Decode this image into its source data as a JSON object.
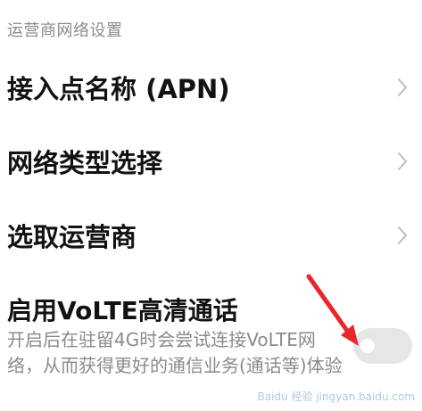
{
  "section_header": "运营商网络设置",
  "items": [
    {
      "label": "接入点名称 (APN)",
      "icon": "chevron-right-icon"
    },
    {
      "label": "网络类型选择",
      "icon": "chevron-right-icon"
    },
    {
      "label": "选取运营商",
      "icon": "chevron-right-icon"
    }
  ],
  "volte": {
    "title": "启用VoLTE高清通话",
    "description": "开启后在驻留4G时会尝试连接VoLTE网络，从而获得更好的通信业务(通话等)体验",
    "toggle_state": "off"
  },
  "annotation": {
    "arrow_icon": "red-arrow-icon",
    "arrow_color": "#e8262b"
  },
  "watermark": "Baidu 经验 jingyan.baidu.com"
}
